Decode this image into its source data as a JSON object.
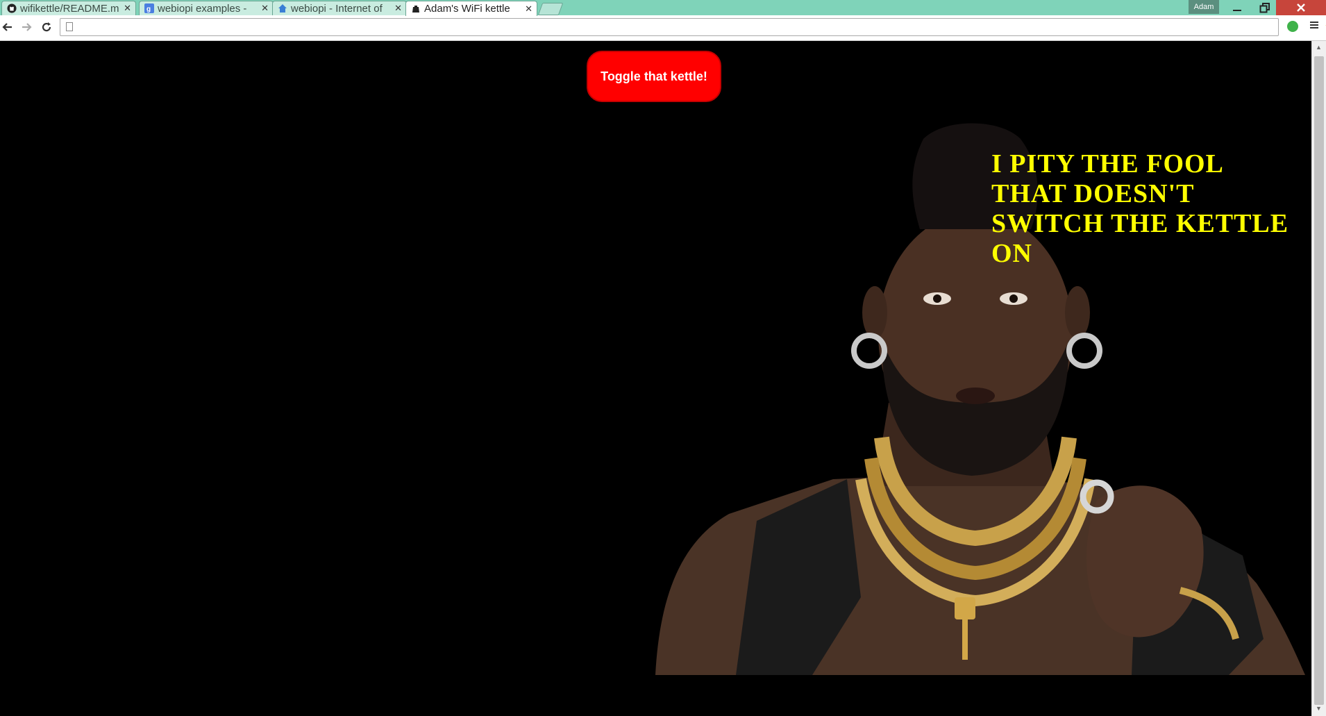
{
  "browser": {
    "tabs": [
      {
        "label": "wifikettle/README.m",
        "icon": "github-icon",
        "active": false
      },
      {
        "label": "webiopi examples - ",
        "icon": "google-icon",
        "active": false
      },
      {
        "label": "webiopi - Internet of",
        "icon": "home-icon",
        "active": false
      },
      {
        "label": "Adam's WiFi kettle",
        "icon": "kettle-icon",
        "active": true
      }
    ],
    "profile_name": "Adam",
    "address": ""
  },
  "page": {
    "toggle_button_label": "Toggle that kettle!",
    "meme_caption": "I PITY THE FOOL THAT DOESN'T SWITCH THE KETTLE ON"
  },
  "colors": {
    "titlebar": "#7fd3b9",
    "button": "#ff0000",
    "caption": "#ffff00",
    "background": "#000000"
  }
}
